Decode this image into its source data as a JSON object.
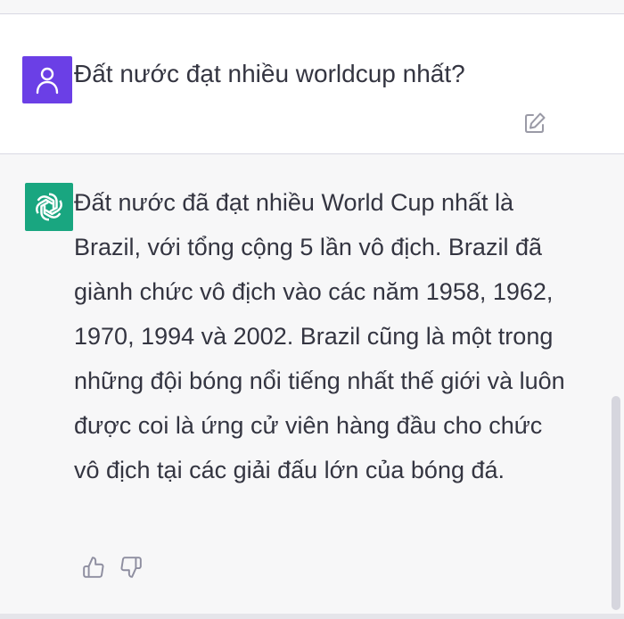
{
  "conversation": {
    "user_message": {
      "text": "Đất nước đạt nhiều worldcup nhất?",
      "avatar_icon": "user-icon",
      "avatar_color": "#6b3fe6",
      "edit_icon": "edit-icon"
    },
    "assistant_message": {
      "text": "Đất nước đã đạt nhiều World Cup nhất là Brazil, với tổng cộng 5 lần vô địch. Brazil đã giành chức vô địch vào các năm 1958, 1962, 1970, 1994 và 2002. Brazil cũng là một trong những đội bóng nổi tiếng nhất thế giới và luôn được coi là ứng cử viên hàng đầu cho chức vô địch tại các giải đấu lớn của bóng đá.",
      "avatar_icon": "openai-logo-icon",
      "avatar_color": "#19a680",
      "feedback_icons": [
        "thumbs-up-icon",
        "thumbs-down-icon"
      ]
    }
  }
}
